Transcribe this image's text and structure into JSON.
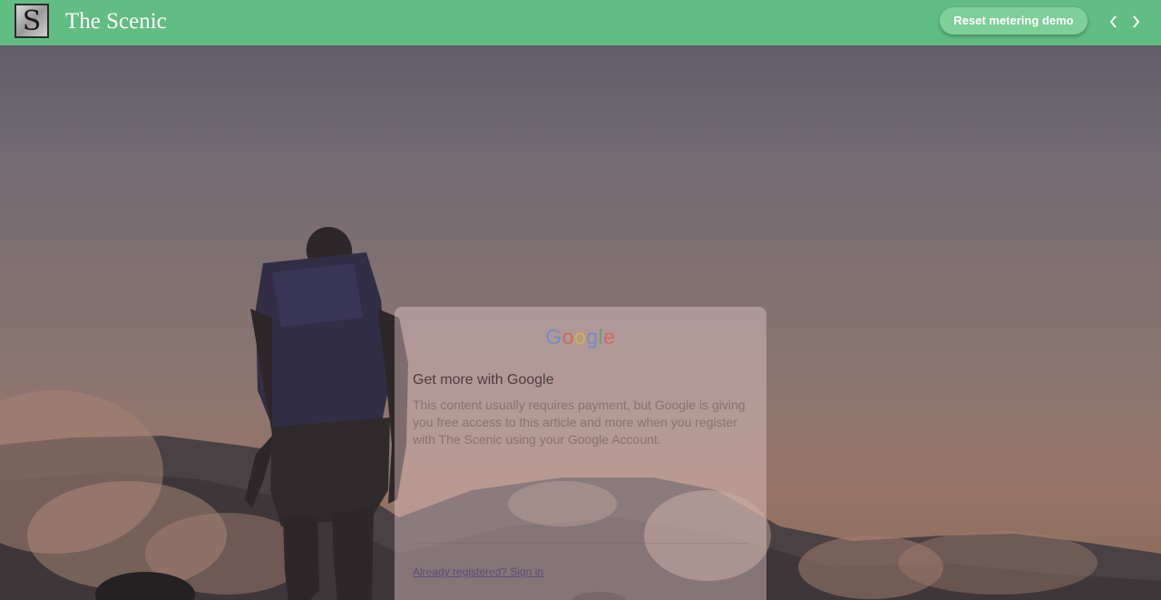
{
  "header": {
    "logo_letter": "S",
    "site_title": "The Scenic",
    "reset_button_label": "Reset metering demo",
    "prev_icon": "chevron-left-icon",
    "next_icon": "chevron-right-icon"
  },
  "dialog": {
    "brand": "Google",
    "heading": "Get more with Google",
    "body": "This content usually requires payment, but Google is giving you free access to this article and more when you register with The Scenic using your Google Account.",
    "signin_link": "Already registered? Sign in"
  },
  "colors": {
    "header_bg": "#62bd82",
    "button_bg": "#7ecf98",
    "google_blue": "#4285F4",
    "google_red": "#EA4335",
    "google_yellow": "#FBBC05",
    "google_green": "#34A853"
  }
}
